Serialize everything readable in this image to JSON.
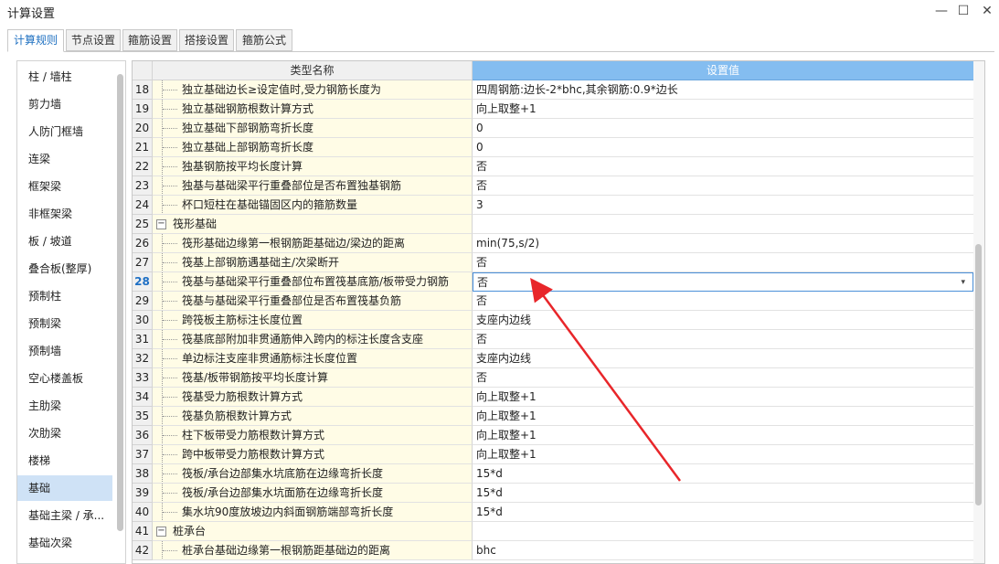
{
  "window": {
    "title": "计算设置",
    "minimize": "—",
    "maximize": "☐",
    "close": "✕"
  },
  "tabs": [
    {
      "label": "计算规则",
      "active": true
    },
    {
      "label": "节点设置",
      "active": false
    },
    {
      "label": "箍筋设置",
      "active": false
    },
    {
      "label": "搭接设置",
      "active": false
    },
    {
      "label": "箍筋公式",
      "active": false
    }
  ],
  "sidebar": {
    "items": [
      {
        "label": "柱 / 墙柱"
      },
      {
        "label": "剪力墙"
      },
      {
        "label": "人防门框墙"
      },
      {
        "label": "连梁"
      },
      {
        "label": "框架梁"
      },
      {
        "label": "非框架梁"
      },
      {
        "label": "板 / 坡道"
      },
      {
        "label": "叠合板(整厚)"
      },
      {
        "label": "预制柱"
      },
      {
        "label": "预制梁"
      },
      {
        "label": "预制墙"
      },
      {
        "label": "空心楼盖板"
      },
      {
        "label": "主肋梁"
      },
      {
        "label": "次肋梁"
      },
      {
        "label": "楼梯"
      },
      {
        "label": "基础",
        "selected": true
      },
      {
        "label": "基础主梁 / 承..."
      },
      {
        "label": "基础次梁"
      }
    ]
  },
  "grid": {
    "header_name": "类型名称",
    "header_value": "设置值",
    "dropdown_glyph": "▾",
    "rows": [
      {
        "num": "18",
        "name": "独立基础边长≥设定值时,受力钢筋长度为",
        "value": "四周钢筋:边长-2*bhc,其余钢筋:0.9*边长"
      },
      {
        "num": "19",
        "name": "独立基础钢筋根数计算方式",
        "value": "向上取整+1"
      },
      {
        "num": "20",
        "name": "独立基础下部钢筋弯折长度",
        "value": "0"
      },
      {
        "num": "21",
        "name": "独立基础上部钢筋弯折长度",
        "value": "0"
      },
      {
        "num": "22",
        "name": "独基钢筋按平均长度计算",
        "value": "否"
      },
      {
        "num": "23",
        "name": "独基与基础梁平行重叠部位是否布置独基钢筋",
        "value": "否"
      },
      {
        "num": "24",
        "name": "杯口短柱在基础锚固区内的箍筋数量",
        "value": "3"
      },
      {
        "num": "25",
        "name": "筏形基础",
        "value": "",
        "group": true,
        "expander": "−"
      },
      {
        "num": "26",
        "name": "筏形基础边缘第一根钢筋距基础边/梁边的距离",
        "value": "min(75,s/2)"
      },
      {
        "num": "27",
        "name": "筏基上部钢筋遇基础主/次梁断开",
        "value": "否"
      },
      {
        "num": "28",
        "name": "筏基与基础梁平行重叠部位布置筏基底筋/板带受力钢筋",
        "value": "否",
        "current": true
      },
      {
        "num": "29",
        "name": "筏基与基础梁平行重叠部位是否布置筏基负筋",
        "value": "否"
      },
      {
        "num": "30",
        "name": "跨筏板主筋标注长度位置",
        "value": "支座内边线"
      },
      {
        "num": "31",
        "name": "筏基底部附加非贯通筋伸入跨内的标注长度含支座",
        "value": "否"
      },
      {
        "num": "32",
        "name": "单边标注支座非贯通筋标注长度位置",
        "value": "支座内边线"
      },
      {
        "num": "33",
        "name": "筏基/板带钢筋按平均长度计算",
        "value": "否"
      },
      {
        "num": "34",
        "name": "筏基受力筋根数计算方式",
        "value": "向上取整+1"
      },
      {
        "num": "35",
        "name": "筏基负筋根数计算方式",
        "value": "向上取整+1"
      },
      {
        "num": "36",
        "name": "柱下板带受力筋根数计算方式",
        "value": "向上取整+1"
      },
      {
        "num": "37",
        "name": "跨中板带受力筋根数计算方式",
        "value": "向上取整+1"
      },
      {
        "num": "38",
        "name": "筏板/承台边部集水坑底筋在边缘弯折长度",
        "value": "15*d"
      },
      {
        "num": "39",
        "name": "筏板/承台边部集水坑面筋在边缘弯折长度",
        "value": "15*d"
      },
      {
        "num": "40",
        "name": "集水坑90度放坡边内斜面钢筋端部弯折长度",
        "value": "15*d"
      },
      {
        "num": "41",
        "name": "桩承台",
        "value": "",
        "group": true,
        "expander": "−"
      },
      {
        "num": "42",
        "name": "桩承台基础边缘第一根钢筋距基础边的距离",
        "value": "bhc"
      }
    ]
  },
  "colors": {
    "accent": "#1e70c1",
    "header_value_bg": "#84bdf0",
    "name_cell_bg": "#fffce6",
    "selected_sidebar_bg": "#cfe2f6",
    "arrow": "#e8262a"
  }
}
